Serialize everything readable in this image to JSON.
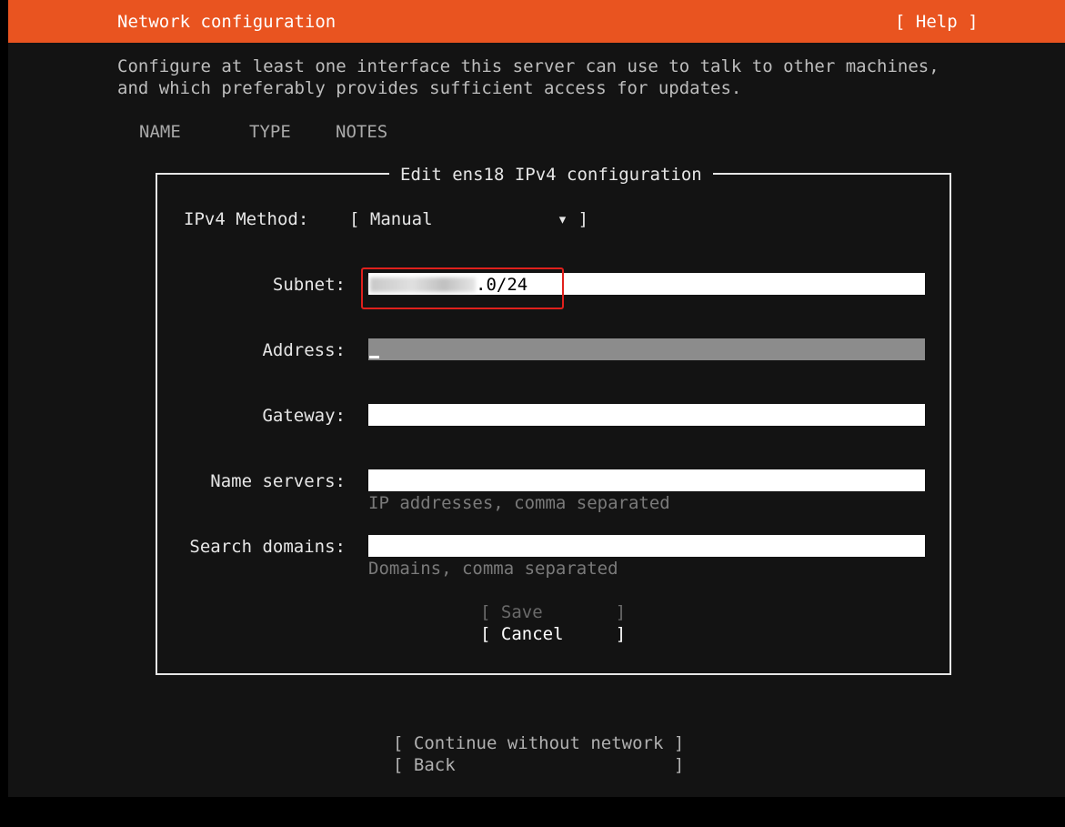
{
  "header": {
    "title": "Network configuration",
    "help_label": "[ Help ]"
  },
  "intro": {
    "line1": "Configure at least one interface this server can use to talk to other machines,",
    "line2": "and which preferably provides sufficient access for updates."
  },
  "table": {
    "columns": [
      "NAME",
      "TYPE",
      "NOTES"
    ]
  },
  "dialog": {
    "title": "Edit ens18 IPv4 configuration",
    "method": {
      "label": "IPv4 Method:",
      "value": "[ Manual            ▾ ]"
    },
    "subnet": {
      "label": "Subnet:",
      "value_visible": ".0/24"
    },
    "address": {
      "label": "Address:",
      "value": ""
    },
    "gateway": {
      "label": "Gateway:",
      "value": ""
    },
    "name_servers": {
      "label": "Name servers:",
      "value": "",
      "hint": "IP addresses, comma separated"
    },
    "search_domains": {
      "label": "Search domains:",
      "value": "",
      "hint": "Domains, comma separated"
    },
    "save_label": "[ Save       ]",
    "cancel_label": "[ Cancel     ]"
  },
  "footer": {
    "continue_label": "[ Continue without network ]",
    "back_label": "[ Back                     ]"
  },
  "colors": {
    "accent": "#e95420",
    "background": "#131313",
    "highlight_box": "#e0201c"
  }
}
